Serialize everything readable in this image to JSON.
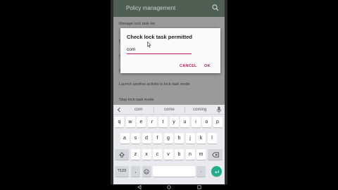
{
  "app": {
    "title": "Policy management",
    "search_icon": "search-icon"
  },
  "prefs": [
    "Manage lock task list",
    "C",
    "S",
    "S",
    "Launch another activity in lock task mode",
    "Stop lock task mode"
  ],
  "dialog": {
    "title": "Check lock task permitted",
    "input_value": "com",
    "cancel_label": "CANCEL",
    "ok_label": "OK"
  },
  "keyboard": {
    "suggestions": [
      "com",
      "come",
      "coming"
    ],
    "row1": [
      "q",
      "w",
      "e",
      "r",
      "t",
      "y",
      "u",
      "i",
      "o",
      "p"
    ],
    "row2": [
      "a",
      "s",
      "d",
      "f",
      "g",
      "h",
      "j",
      "k",
      "l"
    ],
    "row3": [
      "z",
      "x",
      "c",
      "v",
      "b",
      "n",
      "m"
    ],
    "symbols_label": "?123",
    "comma_label": ",",
    "period_label": ".",
    "shift_icon": "shift-icon",
    "backspace_icon": "backspace-icon",
    "emoji_icon": "emoji-icon",
    "enter_icon": "enter-icon"
  },
  "colors": {
    "accent": "#c2185b",
    "app_bar": "#4f5f52",
    "enter_key": "#1eaf8a"
  }
}
